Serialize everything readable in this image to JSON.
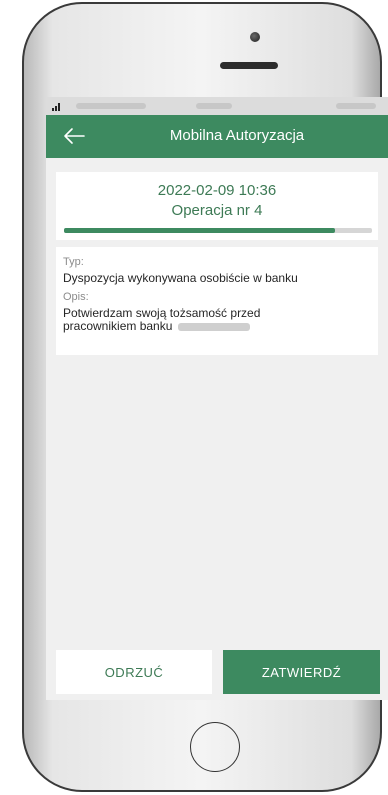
{
  "appbar": {
    "title": "Mobilna Autoryzacja"
  },
  "operation": {
    "datetime": "2022-02-09 10:36",
    "title": "Operacja nr 4",
    "progress_fraction": 0.88
  },
  "details": {
    "type_label": "Typ:",
    "type_value": "Dyspozycja wykonywana osobiście w banku",
    "desc_label": "Opis:",
    "desc_line1": "Potwierdzam swoją tożsamość przed",
    "desc_line2": "pracownikiem banku"
  },
  "actions": {
    "reject_label": "ODRZUĆ",
    "confirm_label": "ZATWIERDŹ"
  },
  "colors": {
    "accent": "#3d8a60",
    "accent_text": "#3d7a55",
    "background": "#f0f0f0"
  },
  "icons": {
    "back": "arrow-left-icon",
    "signal": "signal-icon",
    "home": "home-button-icon"
  }
}
